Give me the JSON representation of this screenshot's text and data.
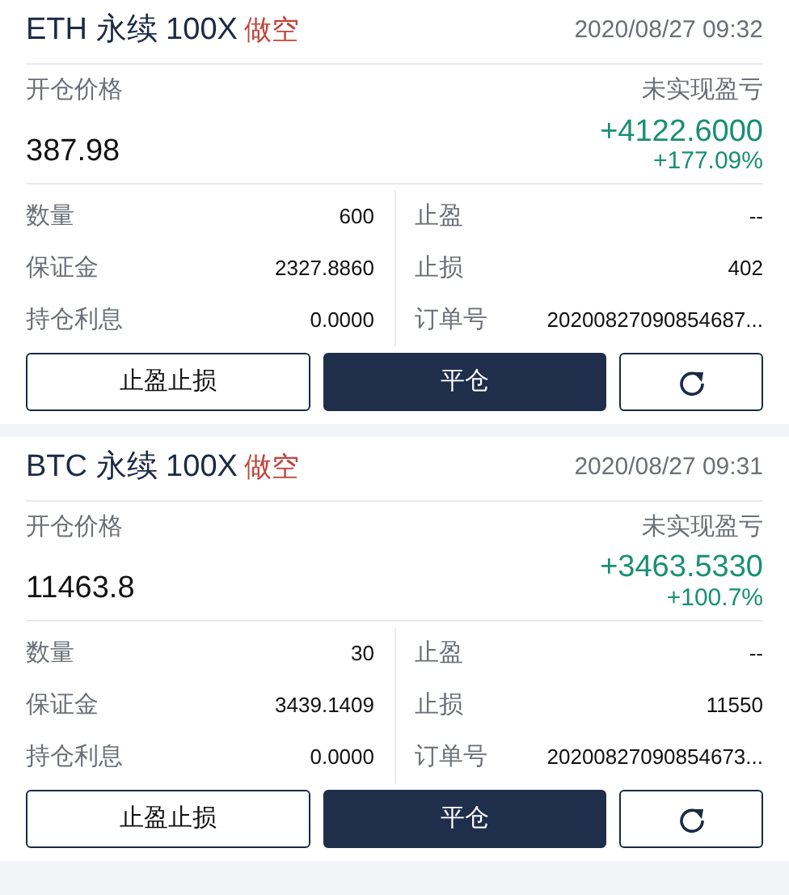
{
  "positions": [
    {
      "symbol": "ETH 永续 100X",
      "side": "做空",
      "time": "2020/08/27 09:32",
      "open_label": "开仓价格",
      "open_price": "387.98",
      "pnl_label": "未实现盈亏",
      "pnl": "+4122.6000",
      "pnl_percent": "+177.09%",
      "left": [
        {
          "label": "数量",
          "value": "600"
        },
        {
          "label": "保证金",
          "value": "2327.8860"
        },
        {
          "label": "持仓利息",
          "value": "0.0000"
        }
      ],
      "right": [
        {
          "label": "止盈",
          "value": "--"
        },
        {
          "label": "止损",
          "value": "402"
        },
        {
          "label": "订单号",
          "value": "20200827090854687..."
        }
      ],
      "buttons": [
        {
          "kind": "outline",
          "label": "止盈止损"
        },
        {
          "kind": "primary",
          "label": "平仓"
        },
        {
          "kind": "share"
        }
      ]
    },
    {
      "symbol": "BTC 永续 100X",
      "side": "做空",
      "time": "2020/08/27 09:31",
      "open_label": "开仓价格",
      "open_price": "11463.8",
      "pnl_label": "未实现盈亏",
      "pnl": "+3463.5330",
      "pnl_percent": "+100.7%",
      "left": [
        {
          "label": "数量",
          "value": "30"
        },
        {
          "label": "保证金",
          "value": "3439.1409"
        },
        {
          "label": "持仓利息",
          "value": "0.0000"
        }
      ],
      "right": [
        {
          "label": "止盈",
          "value": "--"
        },
        {
          "label": "止损",
          "value": "11550"
        },
        {
          "label": "订单号",
          "value": "20200827090854673..."
        }
      ],
      "buttons": [
        {
          "kind": "outline",
          "label": "止盈止损"
        },
        {
          "kind": "primary",
          "label": "平仓"
        },
        {
          "kind": "share"
        }
      ]
    }
  ]
}
